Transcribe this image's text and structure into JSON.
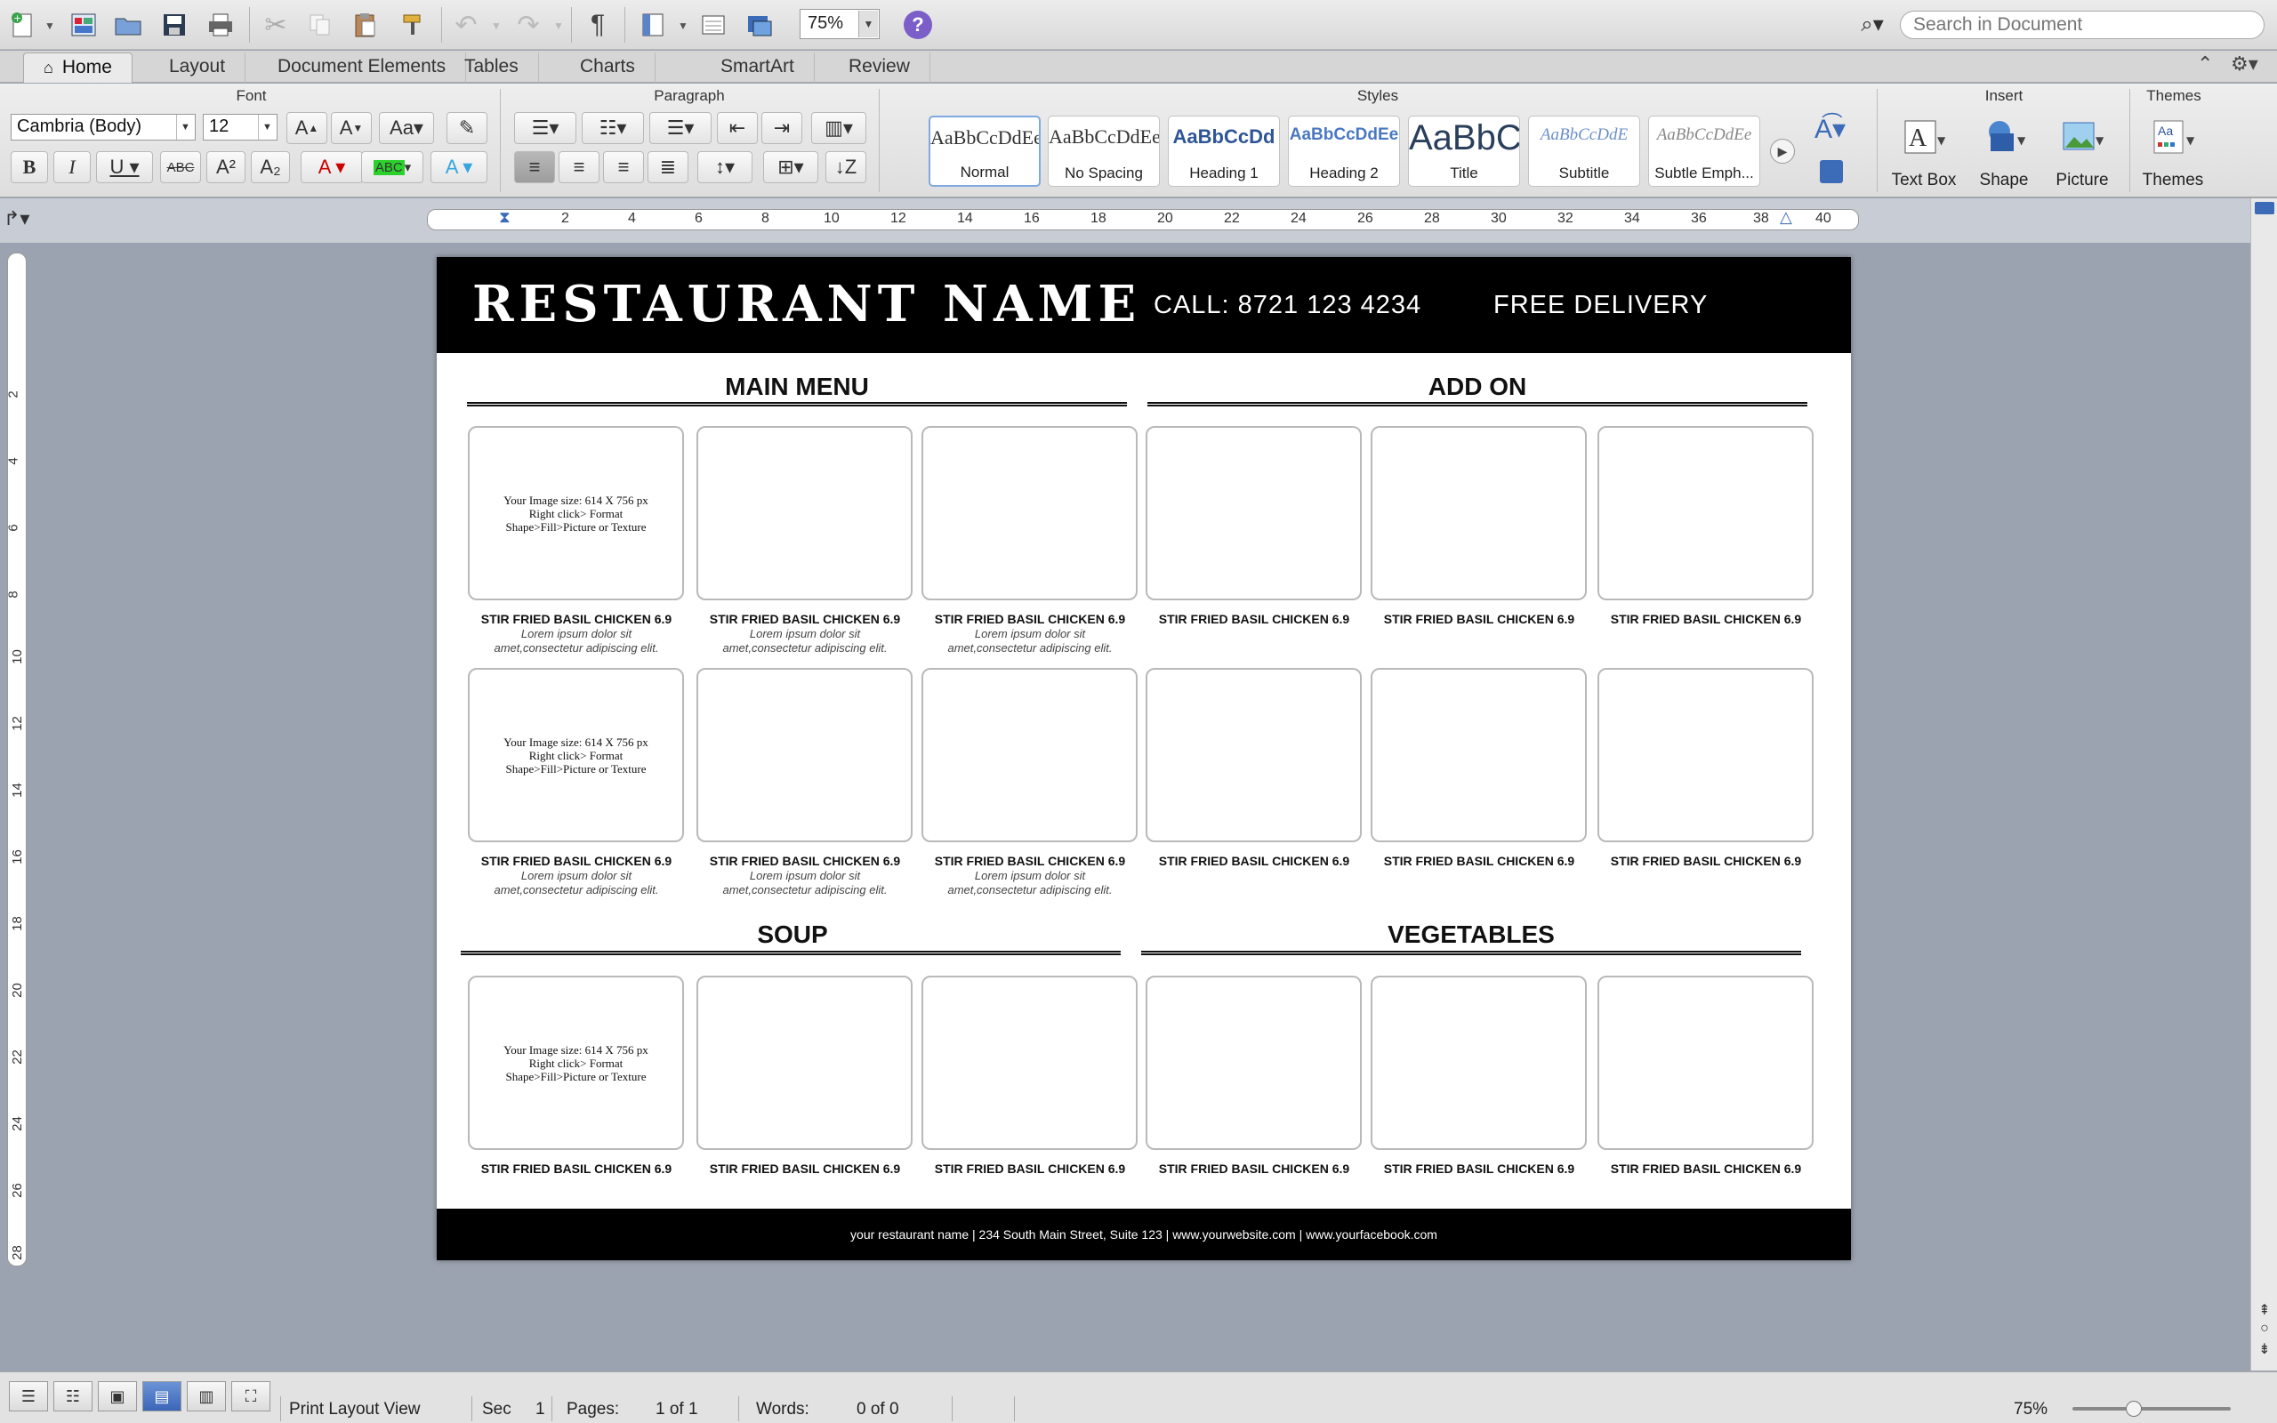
{
  "toolbar": {
    "zoom_value": "75%",
    "search_placeholder": "Search in Document",
    "help_label": "?"
  },
  "tabs": [
    "Home",
    "Layout",
    "Document Elements",
    "Tables",
    "Charts",
    "SmartArt",
    "Review"
  ],
  "ribbon": {
    "groups": {
      "font": "Font",
      "paragraph": "Paragraph",
      "styles": "Styles",
      "insert": "Insert",
      "themes": "Themes"
    },
    "font_name": "Cambria (Body)",
    "font_size": "12",
    "style_gallery": [
      {
        "sample": "AaBbCcDdEe",
        "name": "Normal"
      },
      {
        "sample": "AaBbCcDdEe",
        "name": "No Spacing"
      },
      {
        "sample": "AaBbCcDd",
        "name": "Heading 1"
      },
      {
        "sample": "AaBbCcDdEe",
        "name": "Heading 2"
      },
      {
        "sample": "AaBbC",
        "name": "Title"
      },
      {
        "sample": "AaBbCcDdE",
        "name": "Subtitle"
      },
      {
        "sample": "AaBbCcDdEe",
        "name": "Subtle Emph..."
      }
    ],
    "insert_buttons": [
      "Text Box",
      "Shape",
      "Picture"
    ],
    "themes_button": "Themes"
  },
  "ruler": {
    "h_numbers": [
      "2",
      "4",
      "6",
      "8",
      "10",
      "12",
      "14",
      "16",
      "18",
      "20",
      "22",
      "24",
      "26",
      "28",
      "30",
      "32",
      "34",
      "36",
      "38",
      "40"
    ],
    "v_numbers": [
      "2",
      "4",
      "6",
      "8",
      "10",
      "12",
      "14",
      "16",
      "18",
      "20",
      "22",
      "24",
      "26",
      "28"
    ]
  },
  "document": {
    "restaurant_name": "RESTAURANT NAME",
    "call": "CALL: 8721 123 4234",
    "delivery": "FREE DELIVERY",
    "sections": {
      "main_menu": "MAIN MENU",
      "add_on": "ADD ON",
      "soup": "SOUP",
      "vegetables": "VEGETABLES"
    },
    "image_hint_line1": "Your Image size: 614 X 756 px",
    "image_hint_line2": "Right click> Format",
    "image_hint_line3": "Shape>Fill>Picture or Texture",
    "item_title": "STIR FRIED BASIL CHICKEN 6.9",
    "item_desc_line1": "Lorem ipsum dolor sit",
    "item_desc_line2": "amet,consectetur adipiscing elit.",
    "footer": "your restaurant name  |  234 South Main Street, Suite 123  |  www.yourwebsite.com  |  www.yourfacebook.com"
  },
  "status": {
    "view_mode": "Print Layout View",
    "sec_label": "Sec",
    "sec_value": "1",
    "pages_label": "Pages:",
    "pages_value": "1 of 1",
    "words_label": "Words:",
    "words_value": "0 of 0",
    "zoom": "75%"
  }
}
